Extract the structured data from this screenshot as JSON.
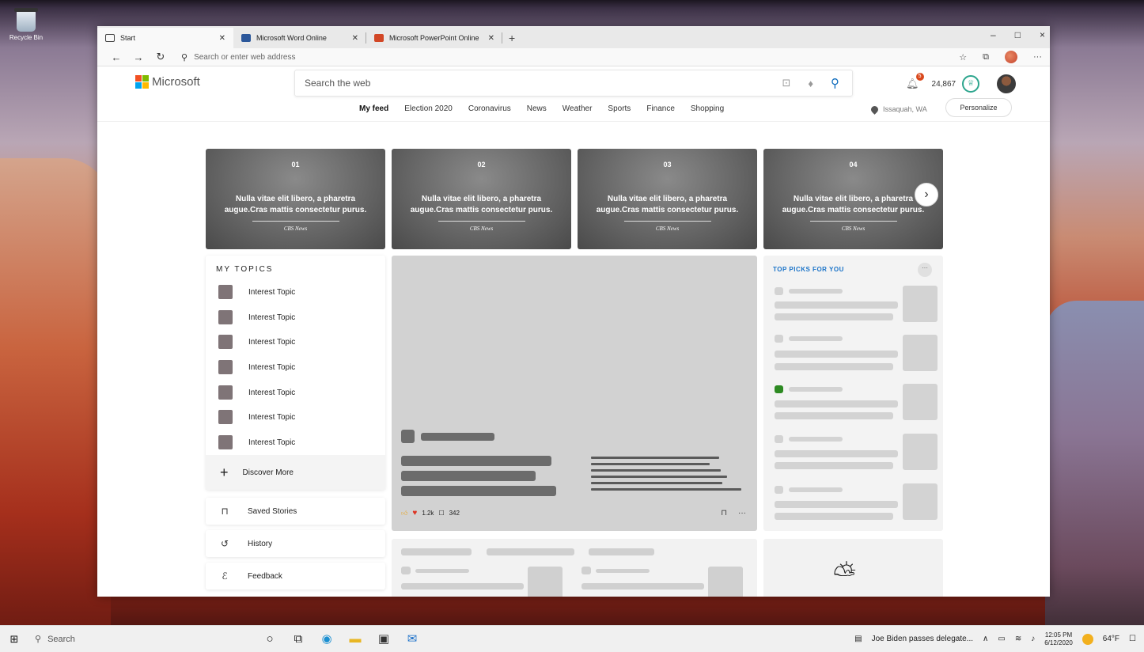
{
  "desktop": {
    "recycle_bin_label": "Recycle Bin"
  },
  "browser": {
    "tabs": [
      {
        "label": "Start",
        "icon": "page-icon",
        "active": true
      },
      {
        "label": "Microsoft Word Online",
        "icon": "word-icon",
        "color": "#2b579a"
      },
      {
        "label": "Microsoft PowerPoint Online",
        "icon": "powerpoint-icon",
        "color": "#d24726"
      }
    ],
    "new_tab": "+",
    "window_controls": [
      "–",
      "□",
      "×"
    ],
    "address_placeholder": "Search or enter web address"
  },
  "msn": {
    "brand": "Microsoft",
    "search_placeholder": "Search the web",
    "notifications_count": "5",
    "rewards_points": "24,867",
    "nav": [
      "My feed",
      "Election 2020",
      "Coronavirus",
      "News",
      "Weather",
      "Sports",
      "Finance",
      "Shopping"
    ],
    "location": "Issaquah, WA",
    "personalize": "Personalize",
    "carousel": [
      {
        "num": "01",
        "text": "Nulla vitae elit libero, a pharetra augue.Cras mattis consectetur purus.",
        "source": "CBS News"
      },
      {
        "num": "02",
        "text": "Nulla vitae elit libero, a pharetra augue.Cras mattis consectetur purus.",
        "source": "CBS News"
      },
      {
        "num": "03",
        "text": "Nulla vitae elit libero, a pharetra augue.Cras mattis consectetur purus.",
        "source": "CBS News"
      },
      {
        "num": "04",
        "text": "Nulla vitae elit libero, a pharetra augue.Cras mattis consectetur purus.",
        "source": "CBS News"
      }
    ],
    "my_topics": {
      "title": "MY TOPICS",
      "items": [
        "Interest Topic",
        "Interest Topic",
        "Interest Topic",
        "Interest Topic",
        "Interest Topic",
        "Interest Topic",
        "Interest Topic"
      ],
      "discover": "Discover More"
    },
    "side_links": {
      "saved": "Saved Stories",
      "history": "History",
      "feedback": "Feedback"
    },
    "hero": {
      "reactions": "1.2k",
      "comments": "342"
    },
    "top_picks_title": "TOP PICKS FOR YOU"
  },
  "taskbar": {
    "search_placeholder": "Search",
    "news_ticker": "Joe Biden passes delegate...",
    "time": "12:05 PM",
    "date": "6/12/2020",
    "temperature": "64°F"
  }
}
